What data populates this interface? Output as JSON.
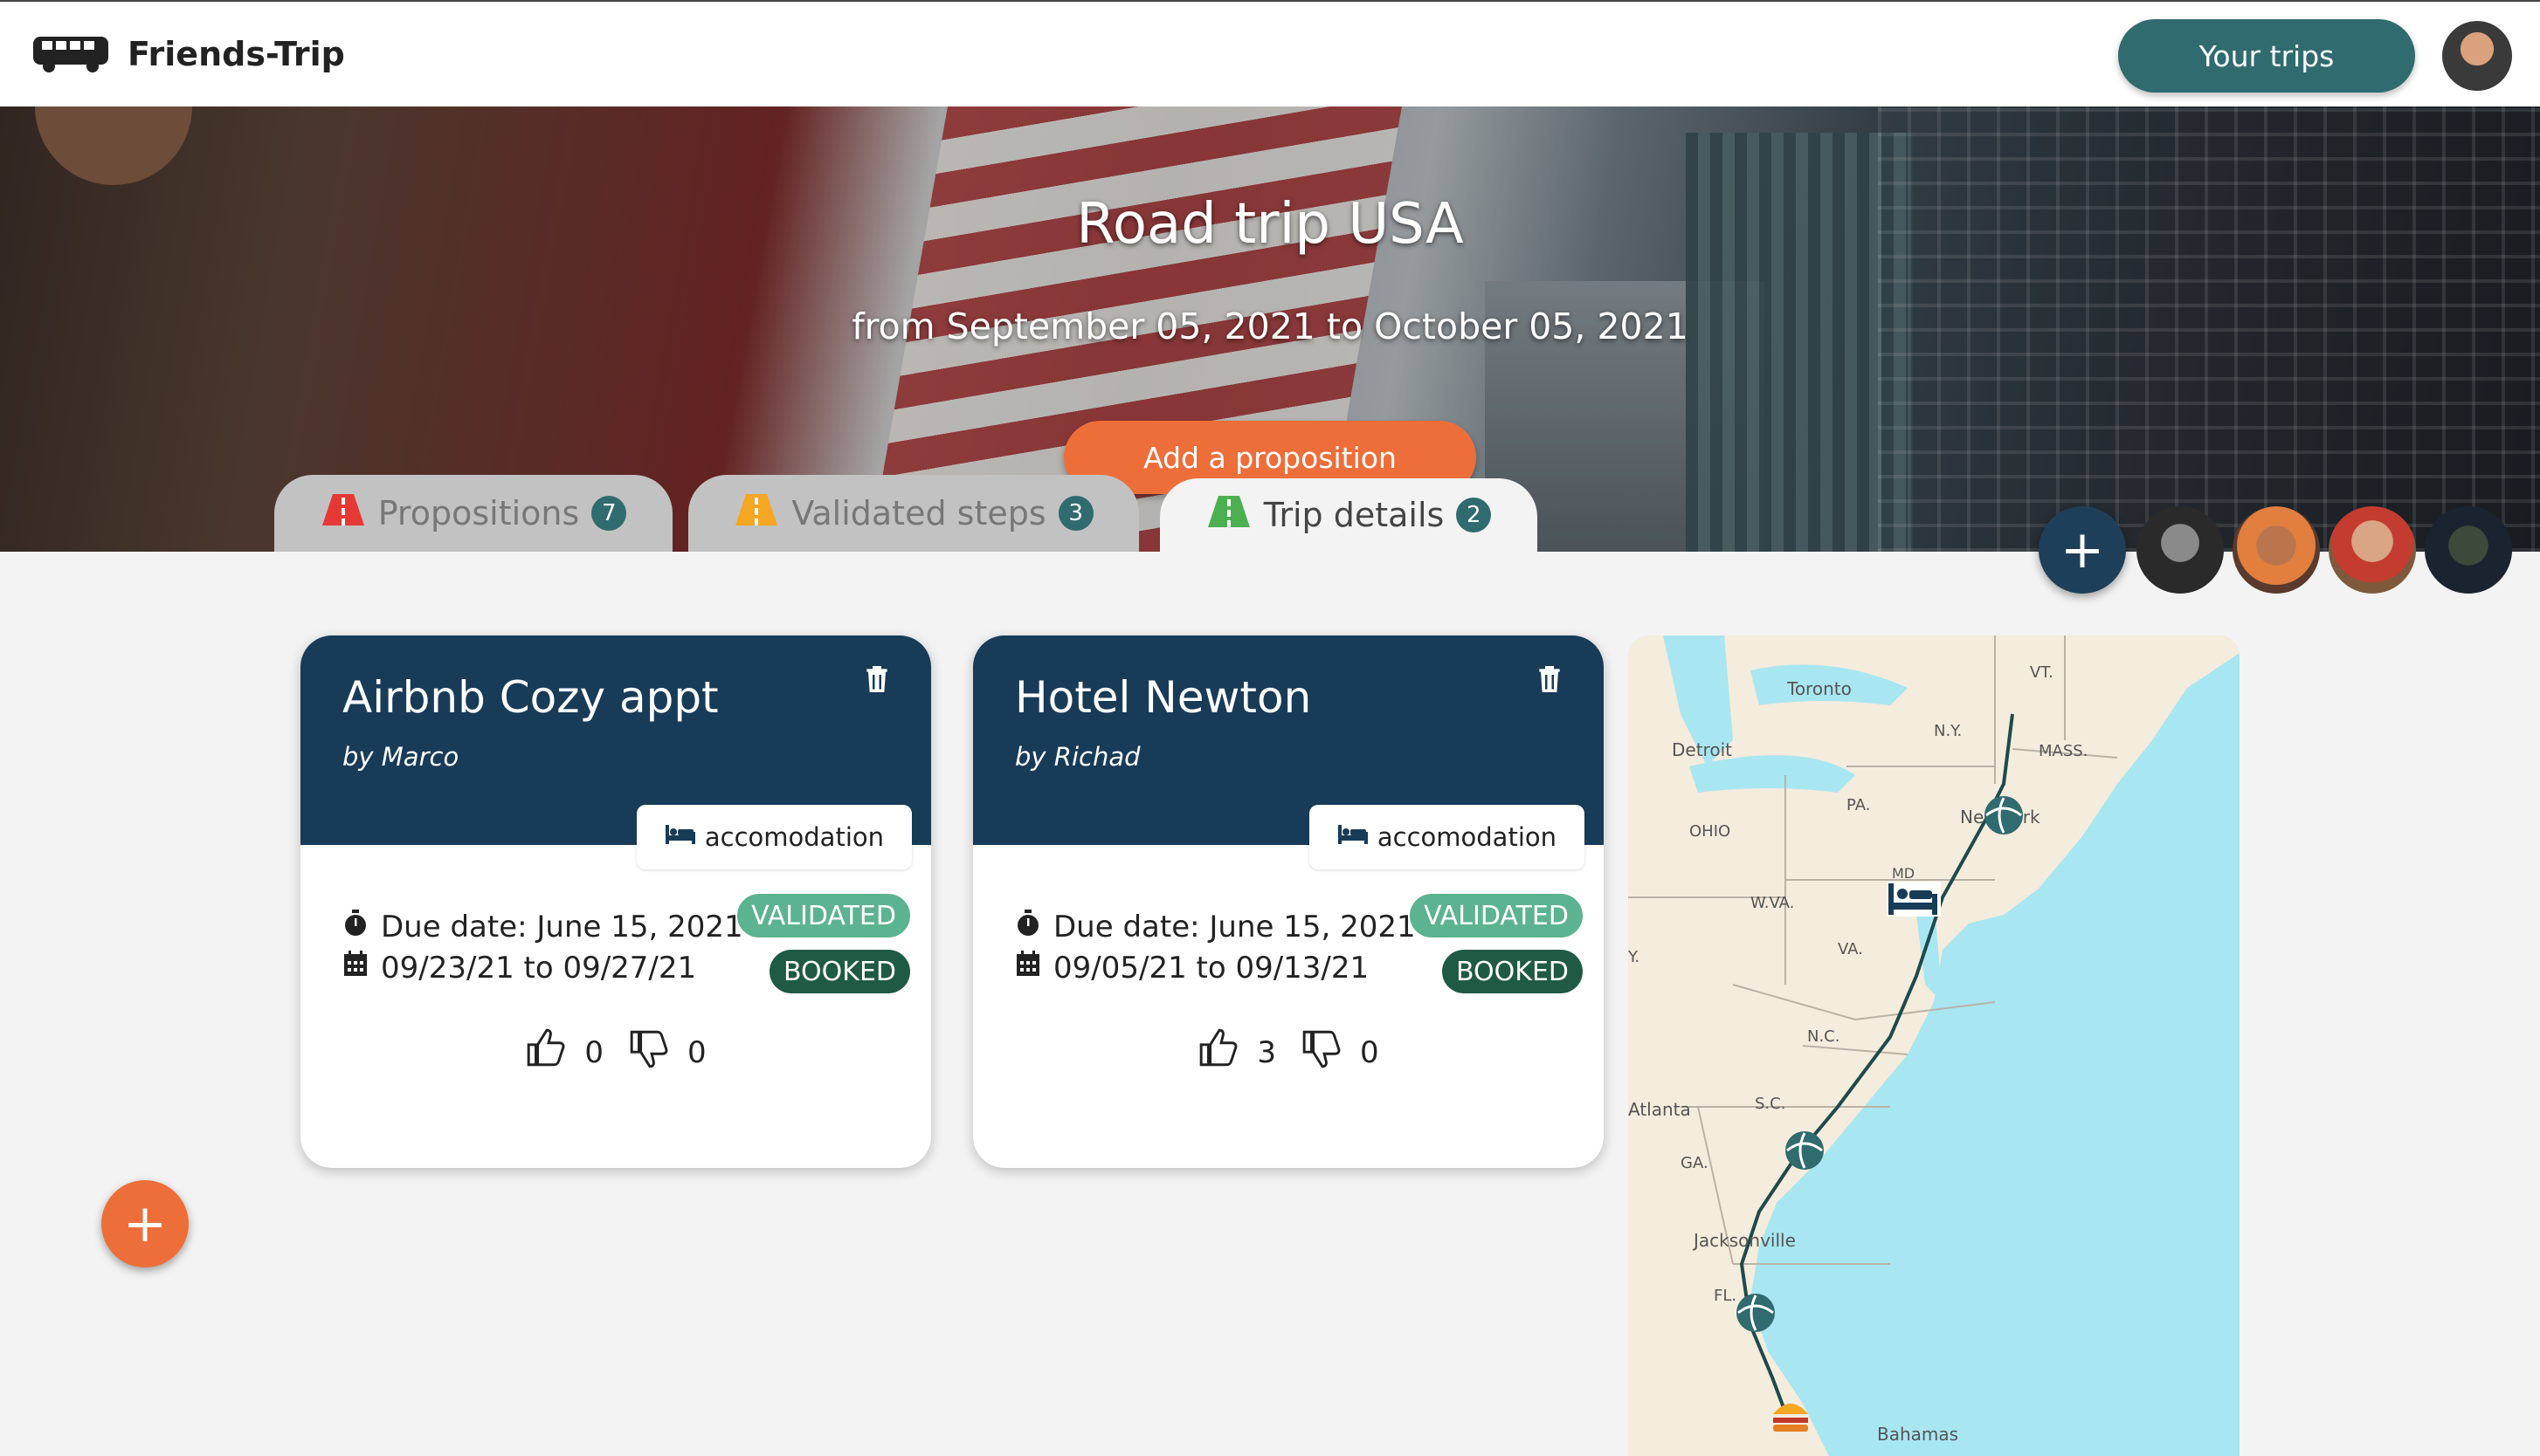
{
  "app": {
    "name": "Friends-Trip"
  },
  "nav": {
    "your_trips_label": "Your trips"
  },
  "trip": {
    "title": "Road trip USA",
    "dates": "from September 05, 2021 to October 05, 2021",
    "add_proposition_label": "Add a proposition"
  },
  "tabs": [
    {
      "label": "Propositions",
      "count": "7",
      "icon_color": "#e53935"
    },
    {
      "label": "Validated steps",
      "count": "3",
      "icon_color": "#f5a623"
    },
    {
      "label": "Trip details",
      "count": "2",
      "icon_color": "#4caf50"
    }
  ],
  "participants": {
    "add_label": "+"
  },
  "cards": [
    {
      "title": "Airbnb Cozy appt",
      "by": "by Marco",
      "category": "accomodation",
      "due_date": "Due date: June 15, 2021",
      "range": "09/23/21 to 09/27/21",
      "status_validated": "VALIDATED",
      "status_booked": "BOOKED",
      "likes": "0",
      "dislikes": "0"
    },
    {
      "title": "Hotel Newton",
      "by": "by Richad",
      "category": "accomodation",
      "due_date": "Due date: June 15, 2021",
      "range": "09/05/21 to 09/13/21",
      "status_validated": "VALIDATED",
      "status_booked": "BOOKED",
      "likes": "3",
      "dislikes": "0"
    }
  ],
  "fab": {
    "label": "+"
  },
  "map": {
    "labels": {
      "toronto": "Toronto",
      "detroit": "Detroit",
      "ohio": "OHIO",
      "pa": "PA.",
      "ny": "N.Y.",
      "vt": "VT.",
      "mass": "MASS.",
      "newyork": "New York",
      "md": "MD",
      "wva": "W.VA.",
      "va": "VA.",
      "nc": "N.C.",
      "sc": "S.C.",
      "atlanta": "Atlanta",
      "ga": "GA.",
      "jacksonville": "Jacksonville",
      "fl": "FL.",
      "bahamas": "Bahamas",
      "ky": "Y."
    }
  },
  "colors": {
    "header_teal": "#2f6b6f",
    "accent_orange": "#ee6e3a",
    "card_navy": "#183b58",
    "validated_green": "#5cb38f",
    "booked_green": "#1e5a44"
  }
}
